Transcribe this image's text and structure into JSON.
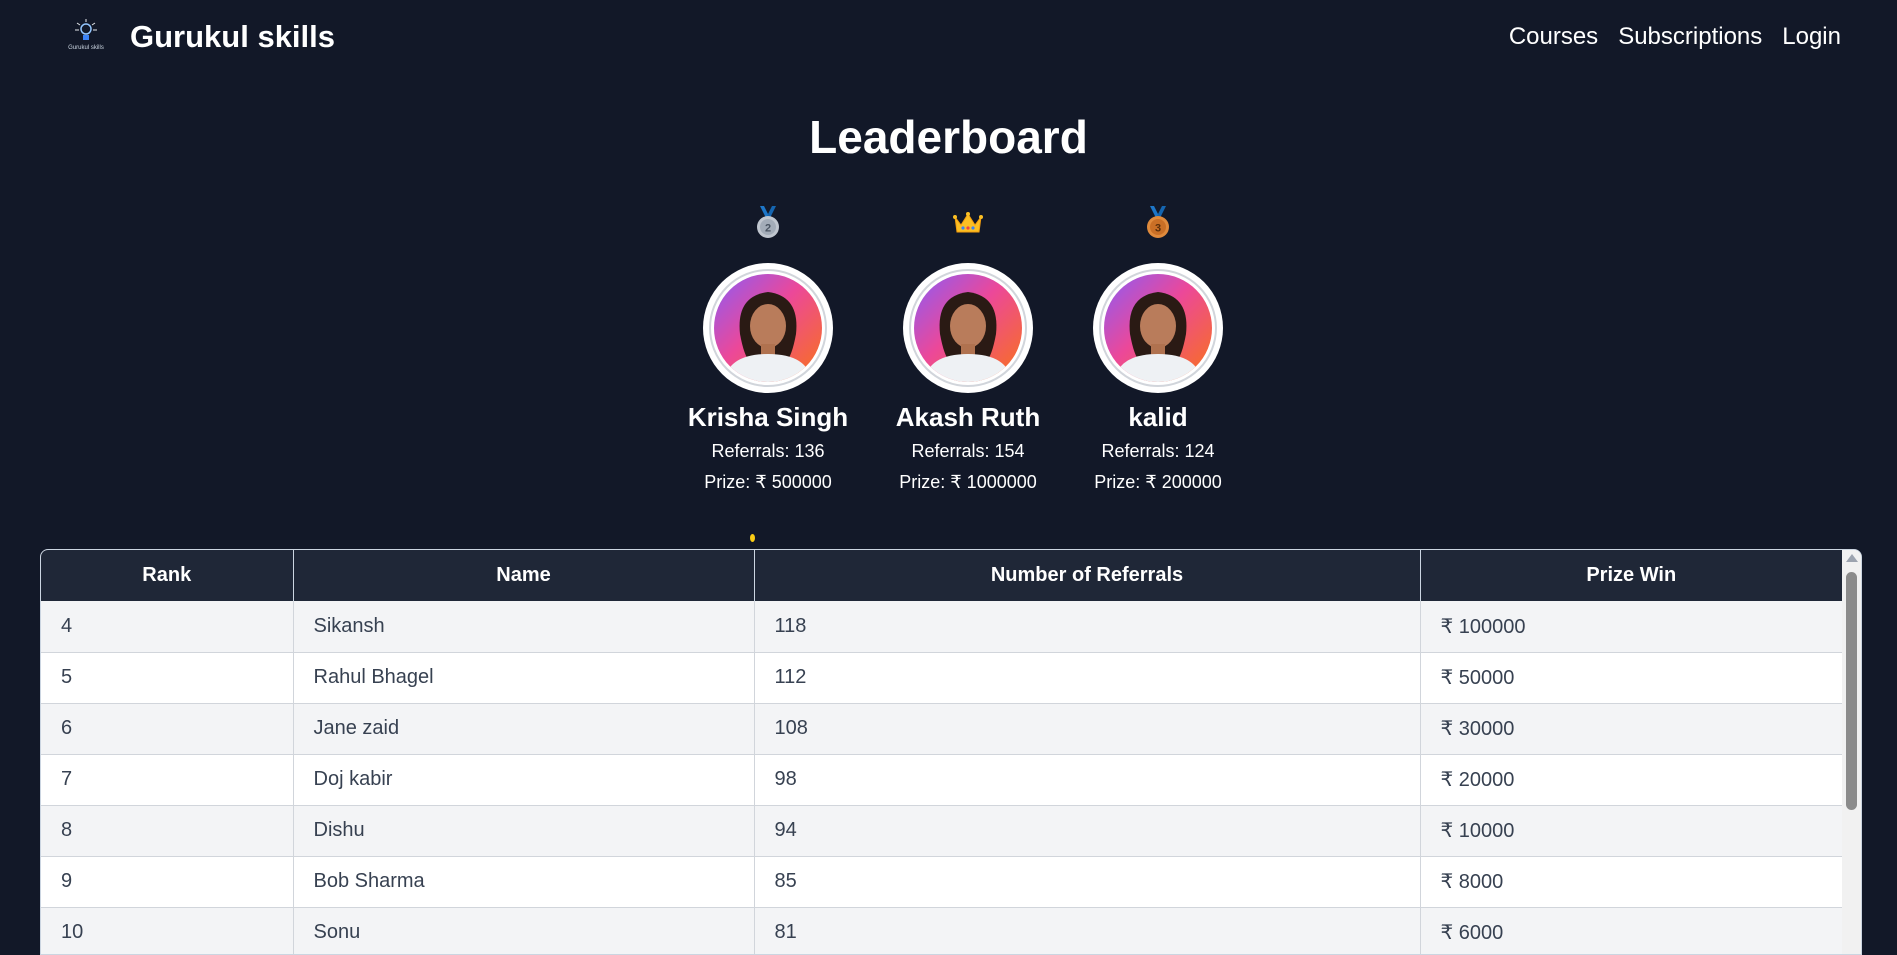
{
  "brand": {
    "name": "Gurukul skills",
    "logo_text": "Gurukul skills"
  },
  "nav": {
    "links": [
      "Courses",
      "Subscriptions",
      "Login"
    ]
  },
  "title": "Leaderboard",
  "podium": [
    {
      "badge": "silver-medal-2-icon",
      "badge_number": "2",
      "name": "Krisha Singh",
      "referrals": "Referrals: 136",
      "prize": "Prize: ₹ 500000"
    },
    {
      "badge": "crown-icon",
      "name": "Akash Ruth",
      "referrals": "Referrals: 154",
      "prize": "Prize: ₹ 1000000"
    },
    {
      "badge": "bronze-medal-3-icon",
      "badge_number": "3",
      "name": "kalid",
      "referrals": "Referrals: 124",
      "prize": "Prize: ₹ 200000"
    }
  ],
  "table": {
    "headers": [
      "Rank",
      "Name",
      "Number of Referrals",
      "Prize Win"
    ],
    "rows": [
      [
        "4",
        "Sikansh",
        "118",
        "₹ 100000"
      ],
      [
        "5",
        "Rahul Bhagel",
        "112",
        "₹ 50000"
      ],
      [
        "6",
        "Jane zaid",
        "108",
        "₹ 30000"
      ],
      [
        "7",
        "Doj kabir",
        "98",
        "₹ 20000"
      ],
      [
        "8",
        "Dishu",
        "94",
        "₹ 10000"
      ],
      [
        "9",
        "Bob Sharma",
        "85",
        "₹ 8000"
      ],
      [
        "10",
        "Sonu",
        "81",
        "₹ 6000"
      ]
    ]
  },
  "colors": {
    "background": "#121828",
    "table_header": "#1f2737",
    "row_alt": "#f3f4f6",
    "crown": "#fbbf24",
    "medal_ribbon": "#1d76c7"
  }
}
